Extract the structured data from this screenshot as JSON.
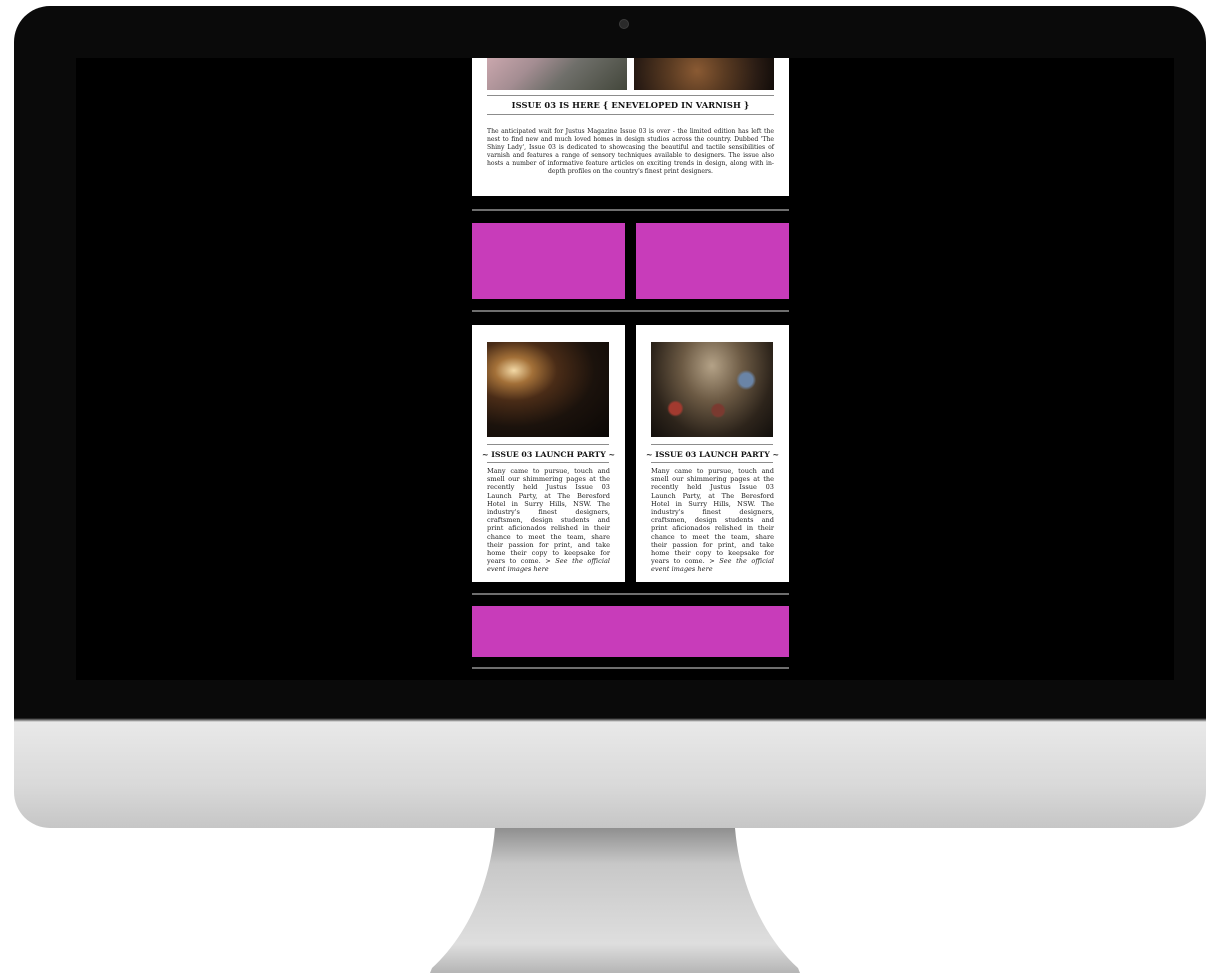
{
  "device": {
    "type": "desktop-monitor"
  },
  "email": {
    "hero_images": [
      {
        "alt": "magazine pages photo"
      },
      {
        "alt": "varnished wood detail photo"
      }
    ],
    "intro": {
      "heading": "ISSUE 03 IS HERE { ENEVELOPED IN VARNISH }",
      "body": "The anticipated wait for Justus Magazine Issue 03 is over - the limited edition has left the nest to find new and much loved homes in design studios across the country. Dubbed 'The Shiny Lady', Issue 03 is dedicated to showcasing the beautiful and tactile sensibilities of varnish and features a range of sensory techniques available to designers. The issue also hosts a number of informative feature articles on exciting trends in design, along with in-depth profiles on the country's finest print designers."
    },
    "placeholder_color": "#c83cba",
    "columns": [
      {
        "heading": "~ ISSUE 03 LAUNCH PARTY ~",
        "body": "Many came to pursue, touch and smell our shimmering pages at the recently held Justus Issue 03 Launch Party, at The Beresford Hotel in Surry Hills, NSW. The industry's finest designers, craftsmen, design students and print aficionados relished in their chance to meet the team, share their passion for print, and take home their copy to keepsake for years to come. > ",
        "link": "See the official event images here"
      },
      {
        "heading": "~ ISSUE 03 LAUNCH PARTY ~",
        "body": "Many came to pursue, touch and smell our shimmering pages at the recently held Justus Issue 03 Launch Party, at The Beresford Hotel in Surry Hills, NSW. The industry's finest designers, craftsmen, design students and print aficionados relished in their chance to meet the team, share their passion for print, and take home their copy to keepsake for years to come. > ",
        "link": "See the official event images here"
      }
    ]
  }
}
